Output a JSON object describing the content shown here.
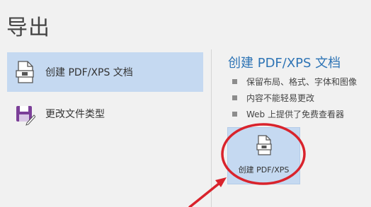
{
  "page": {
    "title": "导出"
  },
  "sidebar": {
    "items": [
      {
        "label": "创建 PDF/XPS 文档",
        "icon": "pdf-document-icon",
        "selected": true
      },
      {
        "label": "更改文件类型",
        "icon": "save-edit-icon",
        "selected": false
      }
    ]
  },
  "detail": {
    "title": "创建 PDF/XPS 文档",
    "bullets": [
      "保留布局、格式、字体和图像",
      "内容不能轻易更改",
      "Web 上提供了免费查看器"
    ],
    "button_label": "创建 PDF/XPS",
    "button_icon": "pdf-document-icon"
  },
  "annotations": {
    "highlight_color": "#d9232c",
    "shapes": [
      "red-ellipse-highlight",
      "red-arrow"
    ]
  },
  "colors": {
    "accent": "#2e74b5",
    "selected_bg": "#c5d9f1",
    "background": "#f1f1f1"
  }
}
